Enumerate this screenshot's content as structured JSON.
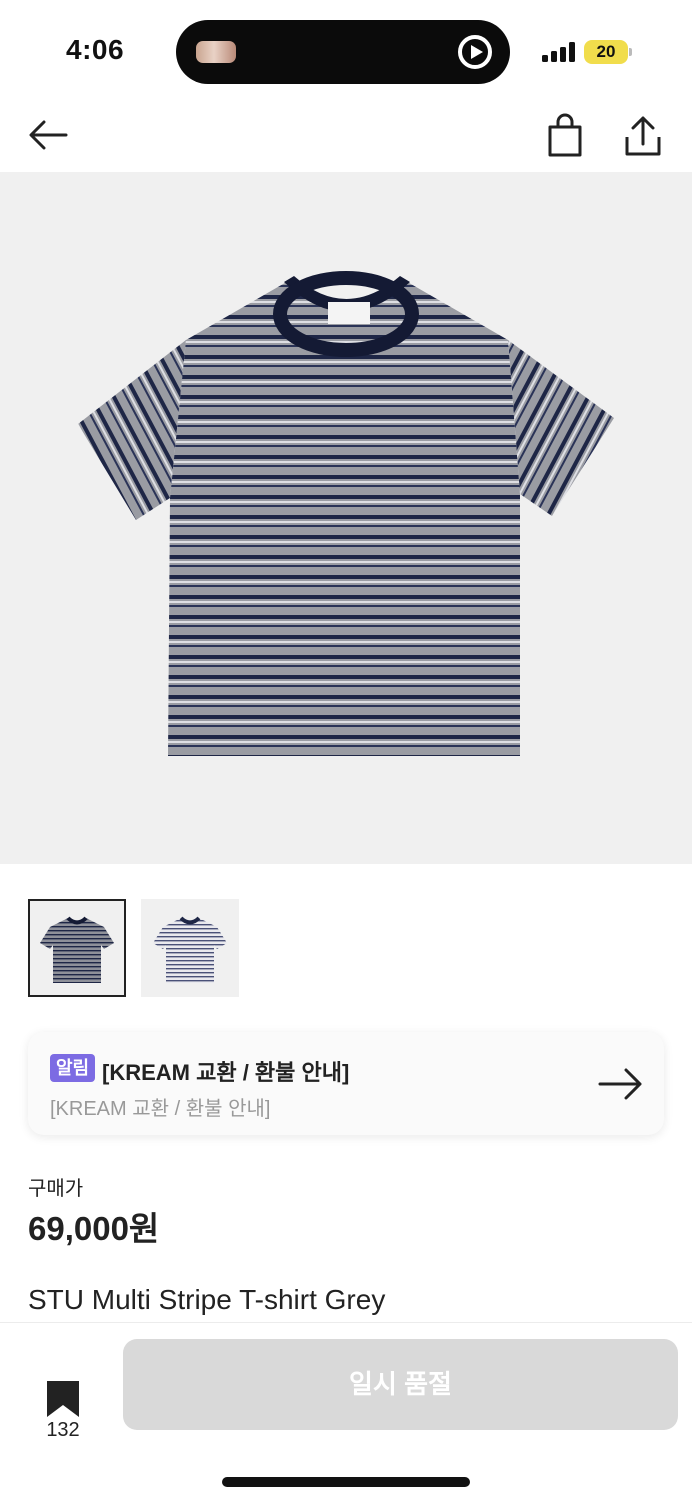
{
  "status_bar": {
    "time": "4:06",
    "battery_level": "20",
    "icons": [
      "media-thumbnail",
      "play-icon",
      "signal-icon",
      "battery-icon"
    ]
  },
  "nav": {
    "icons": [
      "arrow-left-icon",
      "shopping-bag-icon",
      "share-icon"
    ]
  },
  "product": {
    "thumbnails": [
      "grey-navy-stripe-tshirt",
      "white-navy-stripe-tshirt"
    ],
    "colors": {
      "grey_body": "#9a9ca3",
      "navy_stripe": "#1e2646",
      "white_stripe": "#dedfe4",
      "hero_bg": "#f0f0f0"
    }
  },
  "notice": {
    "badge": "알림",
    "title": "[KREAM 교환 / 환불 안내]",
    "subtitle": "[KREAM 교환 / 환불 안내]",
    "badge_color": "#7c6be3"
  },
  "price": {
    "label": "구매가",
    "value": "69,000원"
  },
  "product_name": "STU Multi Stripe T-shirt Grey",
  "bottom_bar": {
    "bookmark_count": "132",
    "soldout_label": "일시 품절",
    "button_color": "#d9d9d9"
  }
}
